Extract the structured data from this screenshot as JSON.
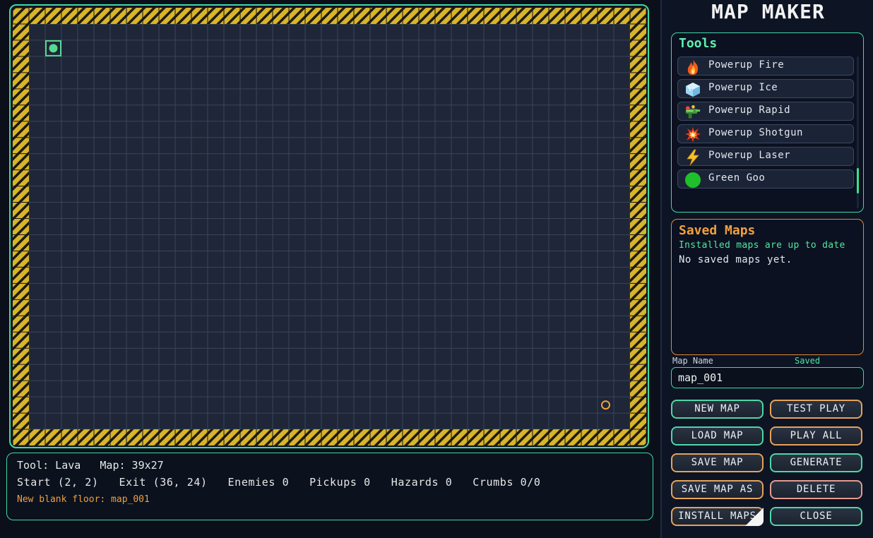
{
  "map": {
    "cols": 39,
    "rows": 27,
    "start": [
      2,
      2
    ],
    "exit": [
      36,
      24
    ],
    "colors": {
      "floor": "#1e2638",
      "grid_line": "#3a455b",
      "wall_yellow": "#d7b42b",
      "wall_dark": "#1e1a0c",
      "frame": "#3fd9a6",
      "start_marker": "#57d98f",
      "exit_marker": "#f0a040"
    }
  },
  "status": {
    "line1": "Tool: Lava   Map: 39x27",
    "line2": "Start (2, 2)   Exit (36, 24)   Enemies 0   Pickups 0   Hazards 0   Crumbs 0/0",
    "line3": "New blank floor: map_001"
  },
  "sidebar": {
    "title": "MAP MAKER",
    "tools": {
      "title": "Tools",
      "items": [
        {
          "label": "Powerup Fire",
          "icon": "fire-icon"
        },
        {
          "label": "Powerup Ice",
          "icon": "ice-cube-icon"
        },
        {
          "label": "Powerup Rapid",
          "icon": "rapid-gun-icon"
        },
        {
          "label": "Powerup Shotgun",
          "icon": "explosion-icon"
        },
        {
          "label": "Powerup Laser",
          "icon": "lightning-icon"
        },
        {
          "label": "Green Goo",
          "icon": "green-goo-icon"
        }
      ]
    },
    "saved_maps": {
      "title": "Saved Maps",
      "status": "Installed maps are up to date",
      "empty_text": "No saved maps yet."
    },
    "map_name": {
      "label": "Map Name",
      "state": "Saved",
      "value": "map_001"
    },
    "buttons": {
      "new_map": "NEW MAP",
      "test_play": "TEST PLAY",
      "load_map": "LOAD MAP",
      "play_all": "PLAY ALL",
      "save_map": "SAVE MAP",
      "generate": "GENERATE",
      "save_map_as": "SAVE MAP AS",
      "delete": "DELETE",
      "install_maps": "INSTALL MAPS",
      "close": "CLOSE"
    }
  }
}
